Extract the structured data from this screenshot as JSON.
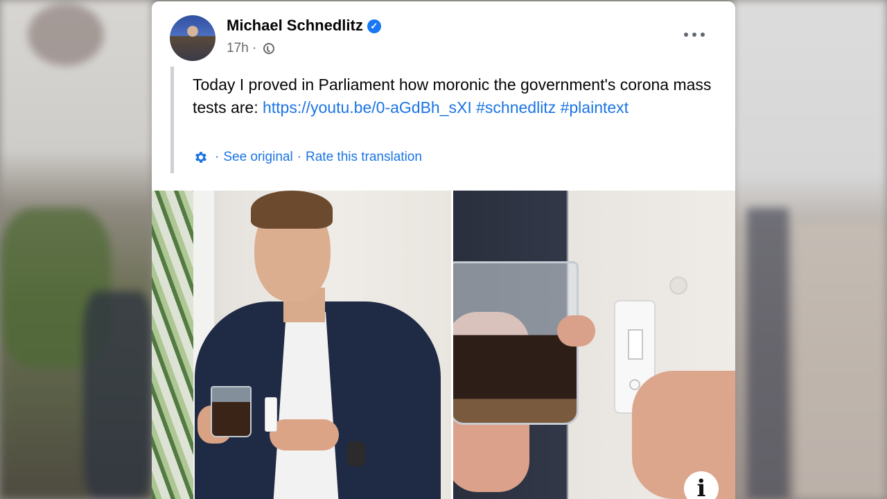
{
  "post": {
    "author": "Michael Schnedlitz",
    "verified_icon": "verified-check-icon",
    "time": "17h",
    "dot": "·",
    "audience_icon": "globe-icon",
    "more_icon": "more-options-icon",
    "text_lead": "Today I proved in Parliament how moronic the government's corona mass tests are: ",
    "link": "https://youtu.be/0-aGdBh_sXI",
    "hashtag1": "#schnedlitz",
    "hashtag2": "#plaintext",
    "translation": {
      "icon": "gear-icon",
      "sep": "·",
      "see_original": "See original",
      "rate": "Rate this translation"
    },
    "info_label": "i"
  },
  "colors": {
    "link": "#1b74e4",
    "verified": "#1877f2",
    "meta": "#65676b"
  }
}
